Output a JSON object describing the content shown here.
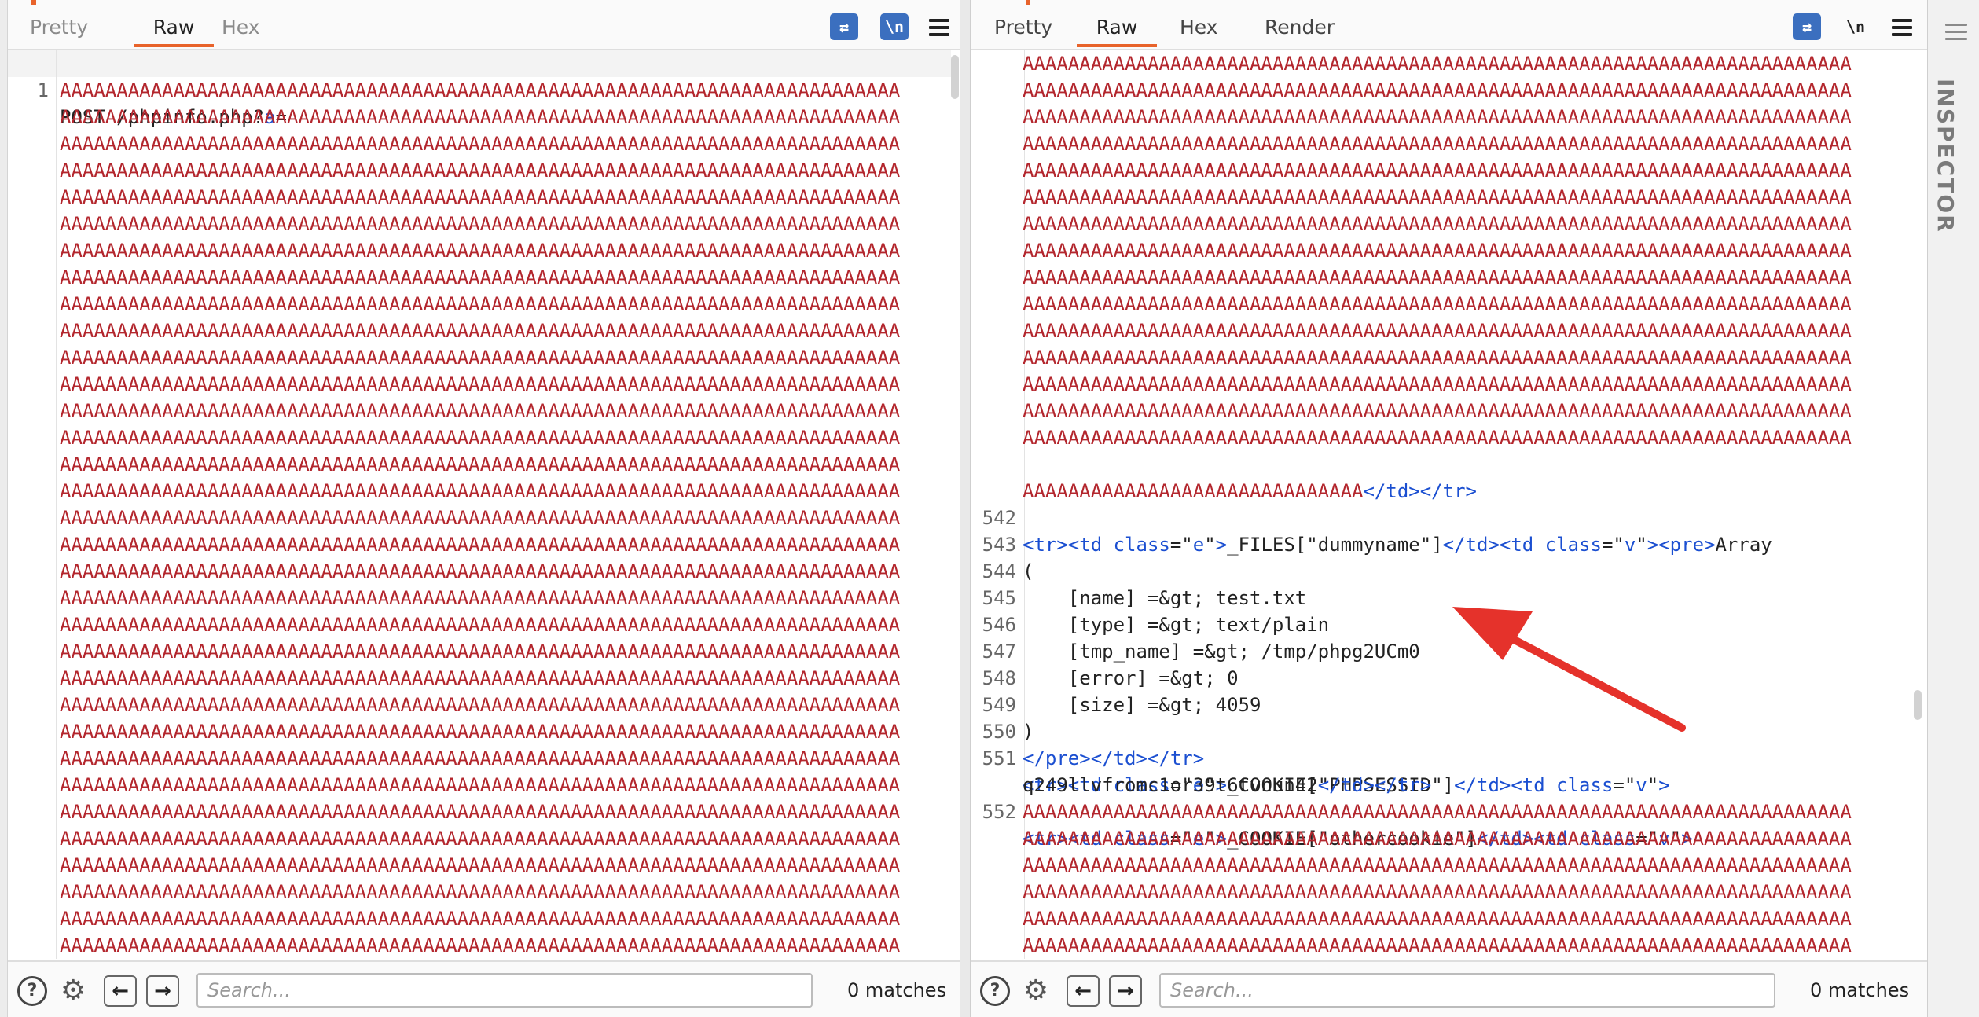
{
  "left_panel": {
    "tabs": [
      "Pretty",
      "Raw",
      "Hex"
    ],
    "active_tab": "Raw",
    "toolbar_icons": [
      "wrap-lines-icon",
      "newline-icon",
      "menu-icon"
    ],
    "newline_label": "\\n",
    "request_line": {
      "number": "1",
      "method_path": "POST /phpinfo.php?",
      "param": "a",
      "equals": "="
    },
    "fill_line": "AAAAAAAAAAAAAAAAAAAAAAAAAAAAAAAAAAAAAAAAAAAAAAAAAAAAAAAAAAAAAAAAAAAAAAAAAA",
    "fill_line_count": 33,
    "search_placeholder": "Search...",
    "matches": "0 matches"
  },
  "right_panel": {
    "tabs": [
      "Pretty",
      "Raw",
      "Hex",
      "Render"
    ],
    "active_tab": "Raw",
    "toolbar_icons": [
      "wrap-lines-icon",
      "newline-icon",
      "menu-icon"
    ],
    "newline_label": "\\n",
    "top_fill_line": "AAAAAAAAAAAAAAAAAAAAAAAAAAAAAAAAAAAAAAAAAAAAAAAAAAAAAAAAAAAAAAAAAAAAAAAAA",
    "top_fill_count": 15,
    "fill_end": "AAAAAAAAAAAAAAAAAAAAAAAAAAAAAA",
    "close_tags": "</td></tr>",
    "lines": {
      "l542": {
        "n": "542",
        "key": "_FILES[\"dummyname\"]",
        "tail": "Array"
      },
      "l543": {
        "n": "543",
        "text": "("
      },
      "l544": {
        "n": "544",
        "text": "    [name] =&gt; test.txt"
      },
      "l545": {
        "n": "545",
        "text": "    [type] =&gt; text/plain"
      },
      "l546": {
        "n": "546",
        "text": "    [tmp_name] =&gt; /tmp/phpg2UCm0"
      },
      "l547": {
        "n": "547",
        "text": "    [error] =&gt; 0"
      },
      "l548": {
        "n": "548",
        "text": "    [size] =&gt; 4059"
      },
      "l549": {
        "n": "549",
        "text": ")"
      },
      "l550": {
        "n": "550"
      },
      "l551": {
        "n": "551",
        "key": "_COOKIE[\"PHPSESSID\"]",
        "value": "q249llvfromc1or39t6tvnun42"
      },
      "l552": {
        "n": "552",
        "key": "_COOKIE[\"othercookie\"]"
      }
    },
    "bottom_fill_count": 6,
    "search_placeholder": "Search...",
    "matches": "0 matches"
  },
  "inspector": {
    "label": "INSPECTOR"
  },
  "colors": {
    "accent": "#e8632b",
    "attr_blue": "#1b4fd1",
    "payload_red": "#b3262d",
    "annotation_arrow": "#e5322b"
  }
}
